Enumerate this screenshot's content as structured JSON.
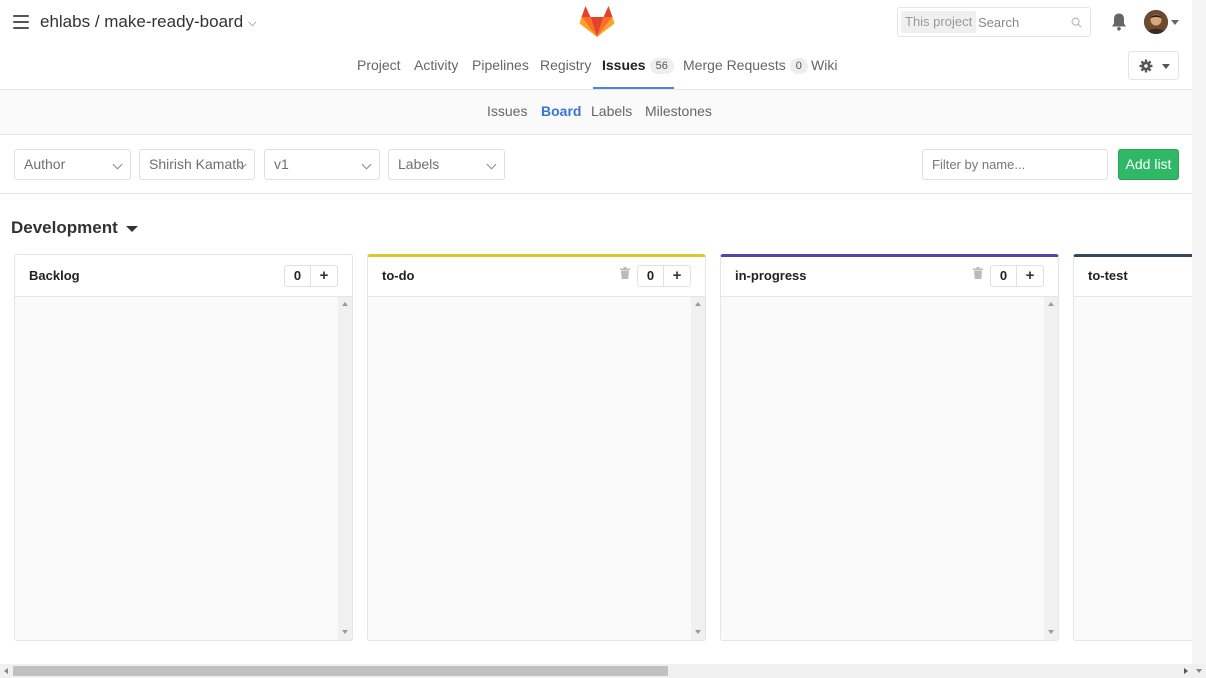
{
  "header": {
    "project_title": "ehlabs / make-ready-board",
    "search_scope": "This project",
    "search_placeholder": "Search"
  },
  "nav": {
    "items": [
      {
        "label": "Project"
      },
      {
        "label": "Activity"
      },
      {
        "label": "Pipelines"
      },
      {
        "label": "Registry"
      },
      {
        "label": "Issues",
        "count": "56"
      },
      {
        "label": "Merge Requests",
        "count": "0"
      },
      {
        "label": "Wiki"
      }
    ]
  },
  "subnav": {
    "items": [
      {
        "label": "Issues"
      },
      {
        "label": "Board"
      },
      {
        "label": "Labels"
      },
      {
        "label": "Milestones"
      }
    ]
  },
  "filters": {
    "author": "Author",
    "assignee": "Shirish Kamath",
    "milestone": "v1",
    "labels": "Labels",
    "filter_placeholder": "Filter by name...",
    "add_list": "Add list"
  },
  "board": {
    "group_title": "Development",
    "lists": [
      {
        "title": "Backlog",
        "count": "0",
        "plus": "+"
      },
      {
        "title": "to-do",
        "count": "0",
        "plus": "+",
        "color": "#d9c92b"
      },
      {
        "title": "in-progress",
        "count": "0",
        "plus": "+",
        "color": "#5843ad"
      },
      {
        "title": "to-test",
        "color": "#34495e"
      }
    ]
  },
  "colors": {
    "active_tab": "#4a88d5",
    "add_list_button": "#2fb866",
    "logo_orange": "#e24329"
  }
}
